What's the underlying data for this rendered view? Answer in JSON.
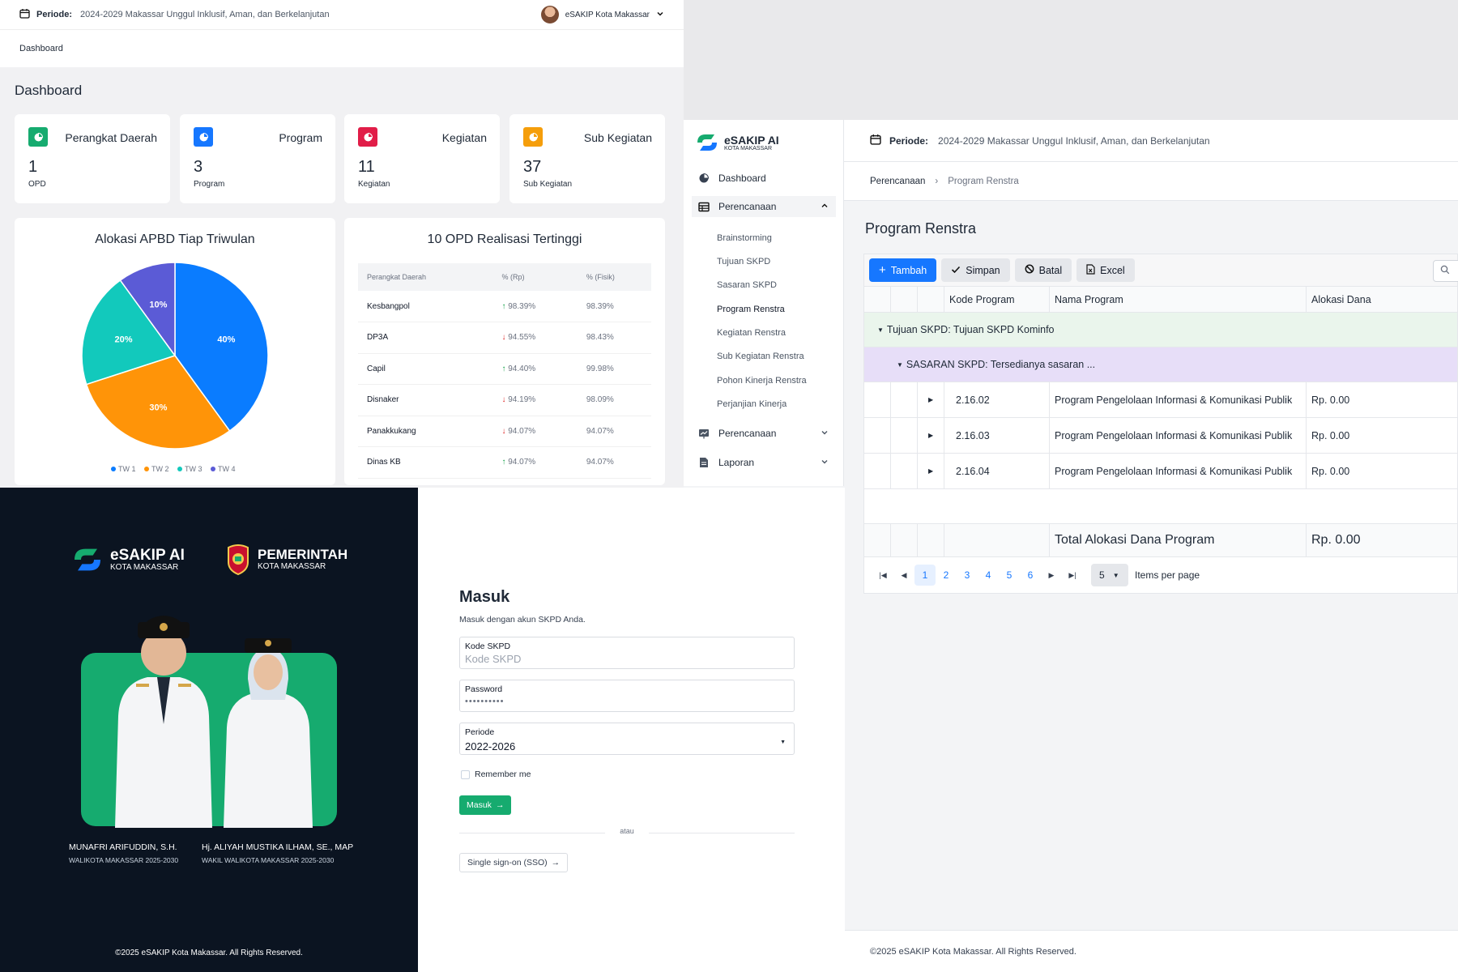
{
  "dash": {
    "period_label": "Periode:",
    "period_value": "2024-2029 Makassar Unggul Inklusif, Aman, dan Berkelanjutan",
    "user_name": "eSAKIP Kota Makassar",
    "breadcrumb": "Dashboard",
    "title": "Dashboard",
    "stats": [
      {
        "title": "Perangkat Daerah",
        "value": "1",
        "unit": "OPD",
        "color": "#16ab6f"
      },
      {
        "title": "Program",
        "value": "3",
        "unit": "Program",
        "color": "#1677ff"
      },
      {
        "title": "Kegiatan",
        "value": "11",
        "unit": "Kegiatan",
        "color": "#e11d48"
      },
      {
        "title": "Sub Kegiatan",
        "value": "37",
        "unit": "Sub Kegiatan",
        "color": "#f59e0b"
      }
    ],
    "opd_table": {
      "title": "10 OPD Realisasi Tertinggi",
      "headers": [
        "Perangkat Daerah",
        "% (Rp)",
        "% (Fisik)"
      ],
      "rows": [
        {
          "name": "Kesbangpol",
          "rp": "98.39%",
          "fisik": "98.39%",
          "trend": "up"
        },
        {
          "name": "DP3A",
          "rp": "94.55%",
          "fisik": "98.43%",
          "trend": "down"
        },
        {
          "name": "Capil",
          "rp": "94.40%",
          "fisik": "99.98%",
          "trend": "up"
        },
        {
          "name": "Disnaker",
          "rp": "94.19%",
          "fisik": "98.09%",
          "trend": "down"
        },
        {
          "name": "Panakkukang",
          "rp": "94.07%",
          "fisik": "94.07%",
          "trend": "down"
        },
        {
          "name": "Dinas KB",
          "rp": "94.07%",
          "fisik": "94.07%",
          "trend": "up"
        }
      ]
    }
  },
  "chart_data": {
    "type": "pie",
    "title": "Alokasi APBD Tiap Triwulan",
    "categories": [
      "TW 1",
      "TW 2",
      "TW 3",
      "TW 4"
    ],
    "values": [
      40,
      30,
      20,
      10
    ],
    "colors": [
      "#0a7cff",
      "#ff9408",
      "#12c9bc",
      "#5b5bd6"
    ],
    "legend": "bottom"
  },
  "renstra": {
    "logo_name": "eSAKIP AI",
    "logo_sub": "KOTA MAKASSAR",
    "nav": {
      "dashboard": "Dashboard",
      "perencanaan": "Perencanaan",
      "perencanaan2": "Perencanaan",
      "laporan": "Laporan"
    },
    "sub_items": [
      "Brainstorming",
      "Tujuan SKPD",
      "Sasaran SKPD",
      "Program Renstra",
      "Kegiatan Renstra",
      "Sub Kegiatan Renstra",
      "Pohon Kinerja Renstra",
      "Perjanjian Kinerja"
    ],
    "period_label": "Periode:",
    "period_value": "2024-2029 Makassar Unggul Inklusif, Aman, dan Berkelanjutan",
    "crumb": [
      "Perencanaan",
      "Program Renstra"
    ],
    "title": "Program Renstra",
    "toolbar": {
      "add": "Tambah",
      "save": "Simpan",
      "cancel": "Batal",
      "excel": "Excel"
    },
    "columns": [
      "Kode Program",
      "Nama Program",
      "Alokasi Dana"
    ],
    "group1": "Tujuan SKPD: Tujuan SKPD Kominfo",
    "group2": "SASARAN SKPD: Tersedianya sasaran ...",
    "rows": [
      {
        "code": "2.16.02",
        "name": "Program Pengelolaan Informasi & Komunikasi Publik",
        "amount": "Rp. 0.00"
      },
      {
        "code": "2.16.03",
        "name": "Program Pengelolaan Informasi & Komunikasi Publik",
        "amount": "Rp. 0.00"
      },
      {
        "code": "2.16.04",
        "name": "Program Pengelolaan Informasi & Komunikasi Publik",
        "amount": "Rp. 0.00"
      }
    ],
    "total_label": "Total Alokasi Dana Program",
    "total_amount": "Rp. 0.00",
    "pages": [
      "1",
      "2",
      "3",
      "4",
      "5",
      "6"
    ],
    "per_page": "5",
    "per_page_label": "Items per page",
    "footer": "©2025 eSAKIP Kota Makassar. All Rights Reserved."
  },
  "login": {
    "logo_name": "eSAKIP AI",
    "logo_sub": "KOTA MAKASSAR",
    "gov_name": "PEMERINTAH",
    "gov_sub": "KOTA MAKASSAR",
    "mayor_name": "MUNAFRI ARIFUDDIN, S.H.",
    "mayor_title": "WALIKOTA MAKASSAR 2025-2030",
    "vice_name": "Hj. ALIYAH MUSTIKA ILHAM, SE., MAP",
    "vice_title": "WAKIL WALIKOTA MAKASSAR 2025-2030",
    "copyright": "©2025 eSAKIP Kota Makassar. All Rights Reserved.",
    "title": "Masuk",
    "subtitle": "Masuk dengan akun SKPD Anda.",
    "kode_label": "Kode SKPD",
    "kode_placeholder": "Kode SKPD",
    "password_label": "Password",
    "password_value": "••••••••••",
    "periode_label": "Periode",
    "periode_value": "2022-2026",
    "remember": "Remember me",
    "submit": "Masuk",
    "divider": "atau",
    "sso": "Single sign-on (SSO)"
  }
}
